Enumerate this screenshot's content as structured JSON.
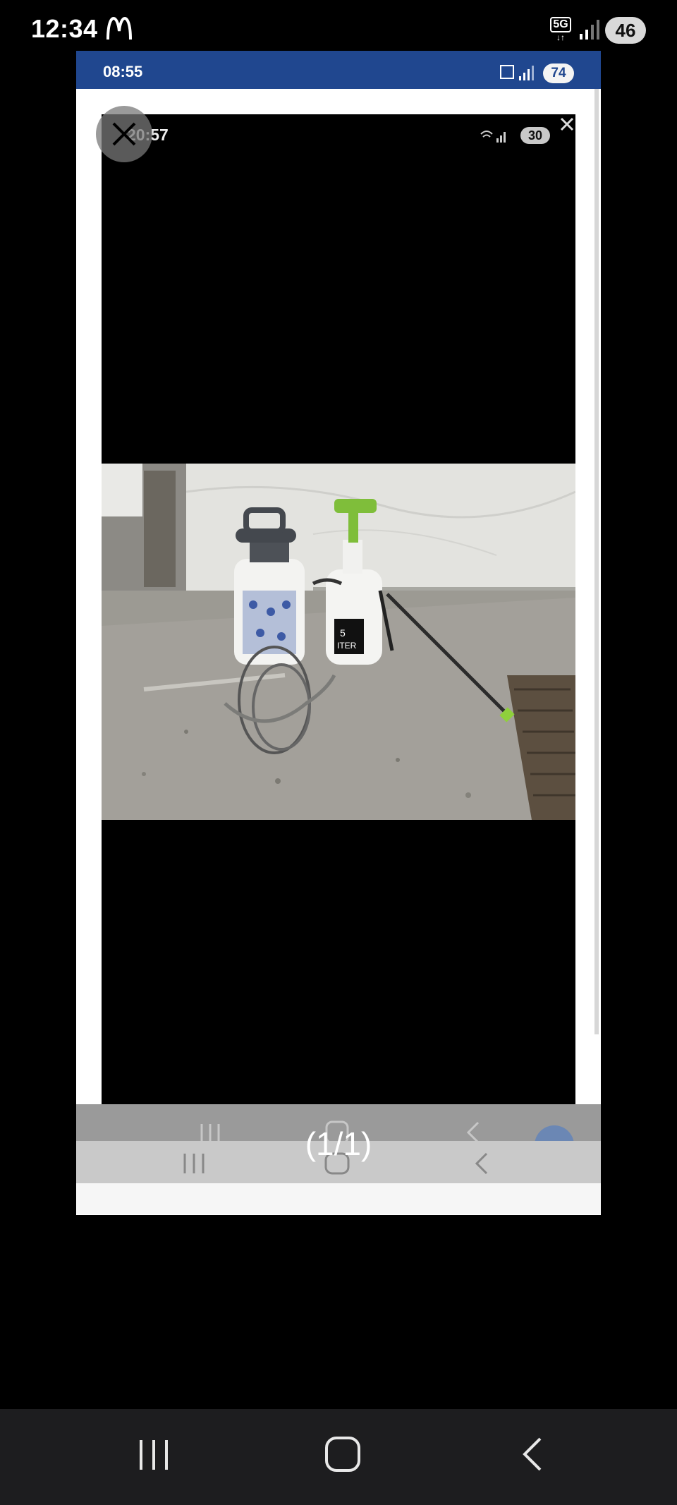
{
  "status_bar": {
    "time": "12:34",
    "network": "5G",
    "battery": "46",
    "icons": [
      "mcdonalds-icon",
      "5g-icon",
      "signal-icon"
    ]
  },
  "screenshot_frame": {
    "time": "08:55",
    "battery": "74",
    "header_color": "#20478f"
  },
  "inner_screenshot": {
    "time": "20:57",
    "battery": "30"
  },
  "viewer": {
    "counter": "(1/1)",
    "close_icon": "close-icon"
  },
  "system_nav": {
    "buttons": [
      "recents-icon",
      "home-icon",
      "back-icon"
    ]
  }
}
